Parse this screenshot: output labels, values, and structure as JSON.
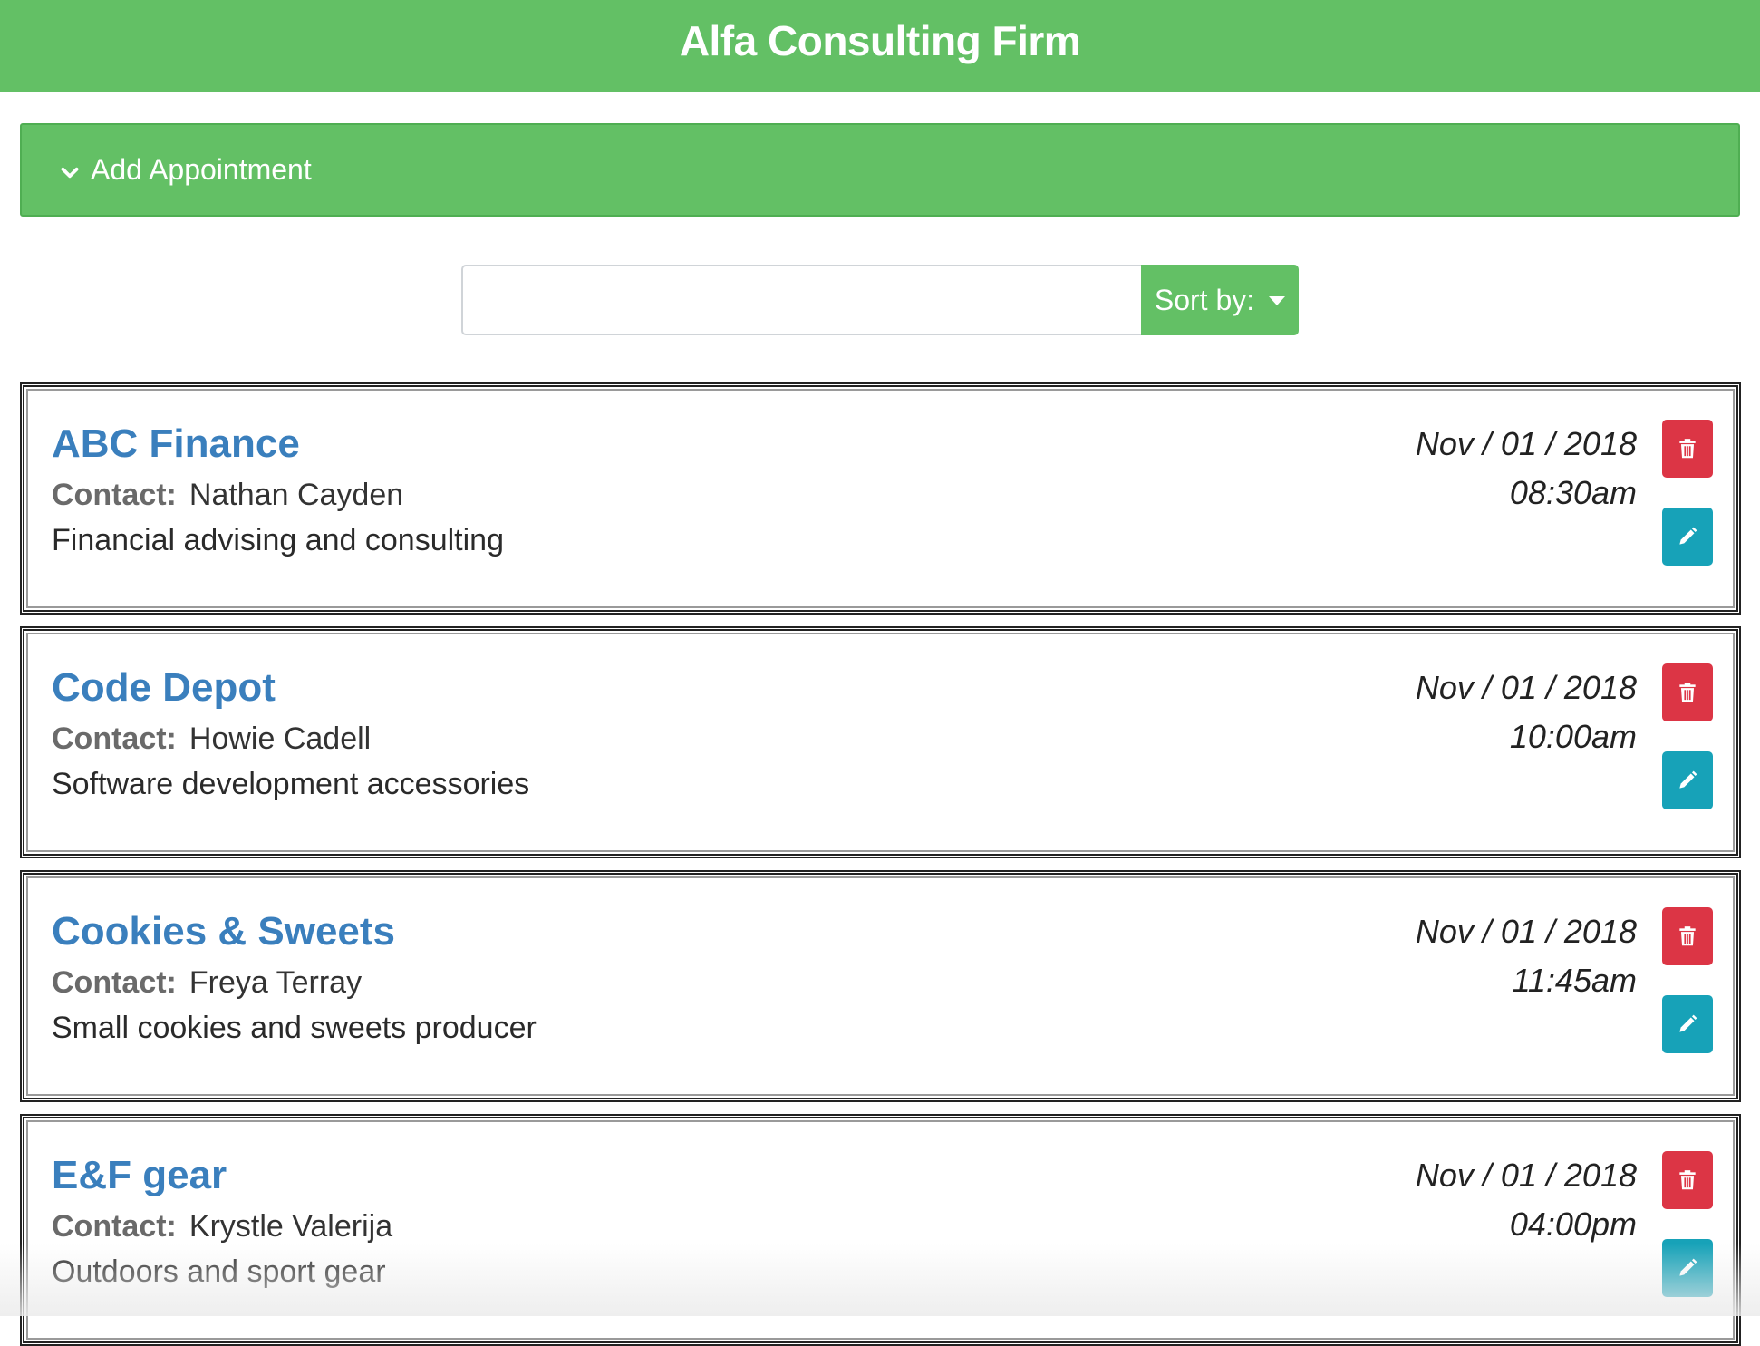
{
  "header": {
    "title": "Alfa Consulting Firm"
  },
  "add_appointment": {
    "label": "Add Appointment",
    "icon": "chevron-down-icon"
  },
  "search": {
    "value": "",
    "placeholder": "",
    "sort_label": "Sort by:"
  },
  "appointments": [
    {
      "company": "ABC Finance",
      "contact_label": "Contact:",
      "contact": "Nathan Cayden",
      "description": "Financial advising and consulting",
      "date": "Nov / 01 / 2018",
      "time": "08:30am"
    },
    {
      "company": "Code Depot",
      "contact_label": "Contact:",
      "contact": "Howie Cadell",
      "description": "Software development accessories",
      "date": "Nov / 01 / 2018",
      "time": "10:00am"
    },
    {
      "company": "Cookies & Sweets",
      "contact_label": "Contact:",
      "contact": "Freya Terray",
      "description": "Small cookies and sweets producer",
      "date": "Nov / 01 / 2018",
      "time": "11:45am"
    },
    {
      "company": "E&F gear",
      "contact_label": "Contact:",
      "contact": "Krystle Valerija",
      "description": "Outdoors and sport gear",
      "date": "Nov / 01 / 2018",
      "time": "04:00pm"
    }
  ],
  "colors": {
    "brand_green": "#63c065",
    "company_blue": "#3a7fbd",
    "delete_red": "#dc3545",
    "edit_teal": "#17a2b8"
  },
  "icons": {
    "delete": "trash-icon",
    "edit": "pencil-icon"
  }
}
